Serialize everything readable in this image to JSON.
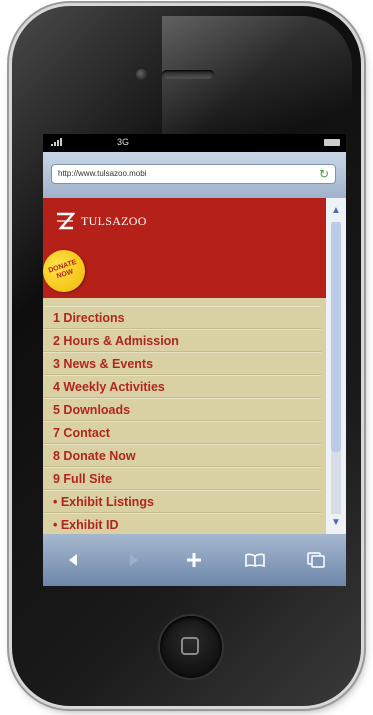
{
  "status_bar": {
    "carrier": "3G"
  },
  "browser": {
    "url": "http://www.tulsazoo.mobi"
  },
  "site": {
    "logo_text": "TULSAZOO",
    "donate_badge": "DONATE NOW"
  },
  "menu": [
    {
      "label": "1 Directions"
    },
    {
      "label": "2 Hours & Admission"
    },
    {
      "label": "3 News & Events"
    },
    {
      "label": "4 Weekly Activities"
    },
    {
      "label": "5 Downloads"
    },
    {
      "label": "7 Contact"
    },
    {
      "label": "8 Donate Now"
    },
    {
      "label": "9 Full Site"
    },
    {
      "label": "• Exhibit Listings"
    },
    {
      "label": "• Exhibit ID"
    }
  ],
  "colors": {
    "header": "#b52119",
    "menu_bg": "#d9d1a3",
    "menu_text": "#b0261c",
    "toolbar": "#7f97b9"
  },
  "icons": {
    "toolbar": [
      "back-icon",
      "forward-icon",
      "add-icon",
      "bookmarks-icon",
      "pages-icon"
    ]
  }
}
